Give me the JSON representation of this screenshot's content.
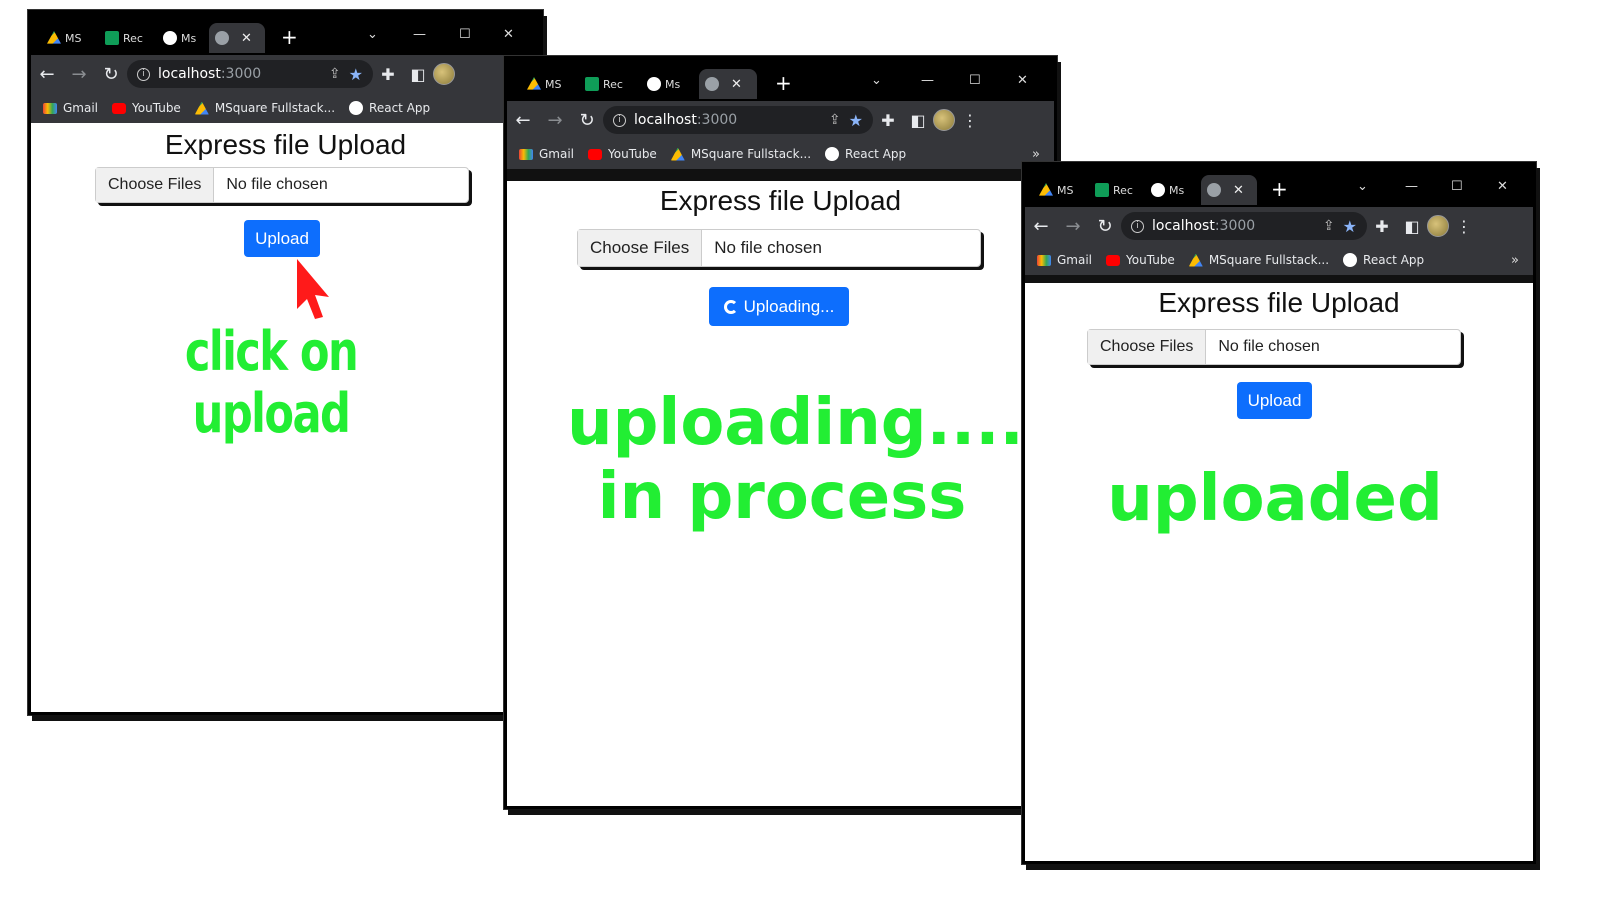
{
  "browser": {
    "tabs": [
      {
        "label": "MS",
        "icon": "google-drive-icon"
      },
      {
        "label": "Rec",
        "icon": "google-sheets-icon"
      },
      {
        "label": "Ms",
        "icon": "github-icon"
      },
      {
        "label": "",
        "icon": "globe-icon",
        "close": "✕"
      }
    ],
    "new_tab": "+",
    "url_host": "localhost",
    "url_port": ":3000",
    "bookmarks": [
      {
        "label": "Gmail",
        "icon": "gmail-icon"
      },
      {
        "label": "YouTube",
        "icon": "youtube-icon"
      },
      {
        "label": "MSquare Fullstack...",
        "icon": "google-drive-icon"
      },
      {
        "label": "React App",
        "icon": "globe-icon"
      }
    ],
    "more_bookmarks": "»"
  },
  "app": {
    "title": "Express file Upload",
    "choose_files": "Choose Files",
    "no_file": "No file chosen",
    "upload_label": "Upload",
    "uploading_label": "Uploading..."
  },
  "annotations": {
    "step1": "click on upload",
    "step2_line1": "uploading....",
    "step2_line2": "in process",
    "step3": "uploaded"
  },
  "colors": {
    "accent_button": "#0d6efd",
    "annotation_green": "#22ee33",
    "cursor_red": "#ff1a1a"
  }
}
